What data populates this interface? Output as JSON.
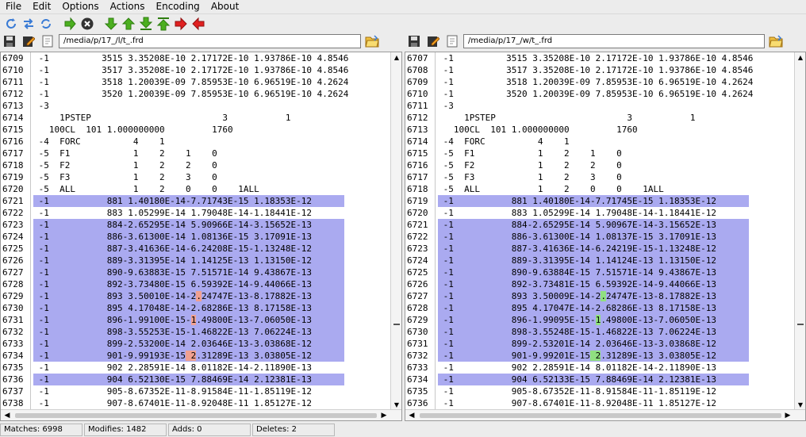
{
  "menu": [
    "File",
    "Edit",
    "Options",
    "Actions",
    "Encoding",
    "About"
  ],
  "toolbar": [
    {
      "name": "refresh-icon",
      "color": "#3a7bd5"
    },
    {
      "name": "swap-files-icon",
      "color": "#3a7bd5"
    },
    {
      "name": "cycle-icon",
      "color": "#3a7bd5"
    },
    {
      "name": "next-arrow-icon",
      "color": "#4caf20"
    },
    {
      "name": "stop-icon",
      "color": "#333333"
    },
    {
      "name": "next-diff-icon",
      "color": "#4caf20"
    },
    {
      "name": "prev-diff-icon",
      "color": "#4caf20"
    },
    {
      "name": "last-diff-icon",
      "color": "#4caf20"
    },
    {
      "name": "first-diff-icon",
      "color": "#4caf20"
    },
    {
      "name": "copy-right-icon",
      "color": "#e02020"
    },
    {
      "name": "copy-left-icon",
      "color": "#e02020"
    }
  ],
  "left": {
    "path": "/media/p/17_/l/t_.frd",
    "lines": [
      {
        "n": "6709",
        "t": " -1          3515 3.35208E-10 2.17172E-10 1.93786E-10 4.8546",
        "hl": false
      },
      {
        "n": "6710",
        "t": " -1          3517 3.35208E-10 2.17172E-10 1.93786E-10 4.8546",
        "hl": false
      },
      {
        "n": "6711",
        "t": " -1          3518 1.20039E-09 7.85953E-10 6.96519E-10 4.2624",
        "hl": false
      },
      {
        "n": "6712",
        "t": " -1          3520 1.20039E-09 7.85953E-10 6.96519E-10 4.2624",
        "hl": false
      },
      {
        "n": "6713",
        "t": " -3",
        "hl": false
      },
      {
        "n": "6714",
        "t": "     1PSTEP                         3           1",
        "hl": false
      },
      {
        "n": "6715",
        "t": "   100CL  101 1.000000000         1760",
        "hl": false
      },
      {
        "n": "6716",
        "t": " -4  FORC          4    1",
        "hl": false
      },
      {
        "n": "6717",
        "t": " -5  F1            1    2    1    0",
        "hl": false
      },
      {
        "n": "6718",
        "t": " -5  F2            1    2    2    0",
        "hl": false
      },
      {
        "n": "6719",
        "t": " -5  F3            1    2    3    0",
        "hl": false
      },
      {
        "n": "6720",
        "t": " -5  ALL           1    2    0    0    1ALL",
        "hl": false
      },
      {
        "n": "6721",
        "t": " -1           881 1.40180E-14-7.71743E-15 1.18353E-12",
        "hl": true
      },
      {
        "n": "6722",
        "t": " -1           883 1.05299E-14 1.79048E-14-1.18441E-12",
        "hl": false
      },
      {
        "n": "6723",
        "t": " -1           884-2.65295E-14 5.90966E-14-3.15652E-13",
        "hl": true
      },
      {
        "n": "6724",
        "t": " -1           886-3.61300E-14 1.08136E-15 3.17091E-13",
        "hl": true
      },
      {
        "n": "6725",
        "t": " -1           887-3.41636E-14-6.24208E-15-1.13248E-12",
        "hl": true
      },
      {
        "n": "6726",
        "t": " -1           889-3.31395E-14 1.14125E-13 1.13150E-12",
        "hl": true
      },
      {
        "n": "6727",
        "t": " -1           890-9.63883E-15 7.51571E-14 9.43867E-13",
        "hl": true
      },
      {
        "n": "6728",
        "t": " -1           892-3.73480E-15 6.59392E-14-9.44066E-13",
        "hl": true
      },
      {
        "n": "6729",
        "t": " -1           893 3.50010E-14-2.24747E-13-8.17882E-13",
        "hl": true,
        "mark": [
          31,
          32
        ]
      },
      {
        "n": "6730",
        "t": " -1           895 4.17048E-14-2.68286E-13 8.17158E-13",
        "hl": true
      },
      {
        "n": "6731",
        "t": " -1           896-1.99100E-15-1.49800E-13-7.06050E-13",
        "hl": true,
        "mark": [
          30,
          31
        ]
      },
      {
        "n": "6732",
        "t": " -1           898-3.55253E-15-1.46822E-13 7.06224E-13",
        "hl": true
      },
      {
        "n": "6733",
        "t": " -1           899-2.53200E-14 2.03646E-13-3.03868E-12",
        "hl": true
      },
      {
        "n": "6734",
        "t": " -1           901-9.99193E-15 2.31289E-13 3.03805E-12",
        "hl": true,
        "mark": [
          29,
          31
        ]
      },
      {
        "n": "6735",
        "t": " -1           902 2.28591E-14 8.01182E-14-2.11890E-13",
        "hl": false
      },
      {
        "n": "6736",
        "t": " -1           904 6.52130E-15 7.88469E-14 2.12381E-13",
        "hl": true
      },
      {
        "n": "6737",
        "t": " -1           905-8.67352E-11-8.91584E-11-1.85119E-12",
        "hl": false
      },
      {
        "n": "6738",
        "t": " -1           907-8.67401E-11-8.92048E-11 1.85127E-12",
        "hl": false
      }
    ]
  },
  "right": {
    "path": "/media/p/17_/w/t_.frd",
    "lines": [
      {
        "n": "6707",
        "t": " -1          3515 3.35208E-10 2.17172E-10 1.93786E-10 4.8546",
        "hl": false
      },
      {
        "n": "6708",
        "t": " -1          3517 3.35208E-10 2.17172E-10 1.93786E-10 4.8546",
        "hl": false
      },
      {
        "n": "6709",
        "t": " -1          3518 1.20039E-09 7.85953E-10 6.96519E-10 4.2624",
        "hl": false
      },
      {
        "n": "6710",
        "t": " -1          3520 1.20039E-09 7.85953E-10 6.96519E-10 4.2624",
        "hl": false
      },
      {
        "n": "6711",
        "t": " -3",
        "hl": false
      },
      {
        "n": "6712",
        "t": "     1PSTEP                         3           1",
        "hl": false
      },
      {
        "n": "6713",
        "t": "   100CL  101 1.000000000         1760",
        "hl": false
      },
      {
        "n": "6714",
        "t": " -4  FORC          4    1",
        "hl": false
      },
      {
        "n": "6715",
        "t": " -5  F1            1    2    1    0",
        "hl": false
      },
      {
        "n": "6716",
        "t": " -5  F2            1    2    2    0",
        "hl": false
      },
      {
        "n": "6717",
        "t": " -5  F3            1    2    3    0",
        "hl": false
      },
      {
        "n": "6718",
        "t": " -5  ALL           1    2    0    0    1ALL",
        "hl": false
      },
      {
        "n": "6719",
        "t": " -1           881 1.40180E-14-7.71745E-15 1.18353E-12",
        "hl": true
      },
      {
        "n": "6720",
        "t": " -1           883 1.05299E-14 1.79048E-14-1.18441E-12",
        "hl": false
      },
      {
        "n": "6721",
        "t": " -1           884-2.65295E-14 5.90967E-14-3.15652E-13",
        "hl": true
      },
      {
        "n": "6722",
        "t": " -1           886-3.61300E-14 1.08137E-15 3.17091E-13",
        "hl": true
      },
      {
        "n": "6723",
        "t": " -1           887-3.41636E-14-6.24219E-15-1.13248E-12",
        "hl": true
      },
      {
        "n": "6724",
        "t": " -1           889-3.31395E-14 1.14124E-13 1.13150E-12",
        "hl": true
      },
      {
        "n": "6725",
        "t": " -1           890-9.63884E-15 7.51571E-14 9.43867E-13",
        "hl": true
      },
      {
        "n": "6726",
        "t": " -1           892-3.73481E-15 6.59392E-14-9.44066E-13",
        "hl": true
      },
      {
        "n": "6727",
        "t": " -1           893 3.50009E-14-2.24747E-13-8.17882E-13",
        "hl": true,
        "mark": [
          31,
          32
        ]
      },
      {
        "n": "6728",
        "t": " -1           895 4.17047E-14-2.68286E-13 8.17158E-13",
        "hl": true
      },
      {
        "n": "6729",
        "t": " -1           896-1.99095E-15-1.49800E-13-7.06050E-13",
        "hl": true,
        "mark": [
          30,
          31
        ]
      },
      {
        "n": "6730",
        "t": " -1           898-3.55248E-15-1.46822E-13 7.06224E-13",
        "hl": true
      },
      {
        "n": "6731",
        "t": " -1           899-2.53201E-14 2.03646E-13-3.03868E-12",
        "hl": true
      },
      {
        "n": "6732",
        "t": " -1           901-9.99201E-15 2.31289E-13 3.03805E-12",
        "hl": true,
        "mark": [
          29,
          31
        ]
      },
      {
        "n": "6733",
        "t": " -1           902 2.28591E-14 8.01182E-14-2.11890E-13",
        "hl": false
      },
      {
        "n": "6734",
        "t": " -1           904 6.52133E-15 7.88469E-14 2.12381E-13",
        "hl": true
      },
      {
        "n": "6735",
        "t": " -1           905-8.67352E-11-8.91584E-11-1.85119E-12",
        "hl": false
      },
      {
        "n": "6736",
        "t": " -1           907-8.67401E-11-8.92048E-11 1.85127E-12",
        "hl": false
      }
    ]
  },
  "status": {
    "matches": "Matches: 6998",
    "modifies": "Modifies: 1482",
    "adds": "Adds: 0",
    "deletes": "Deletes: 2"
  },
  "colors": {
    "highlight": "#aaaaf0",
    "left_diff": "#f0a090",
    "right_diff": "#90e080"
  }
}
